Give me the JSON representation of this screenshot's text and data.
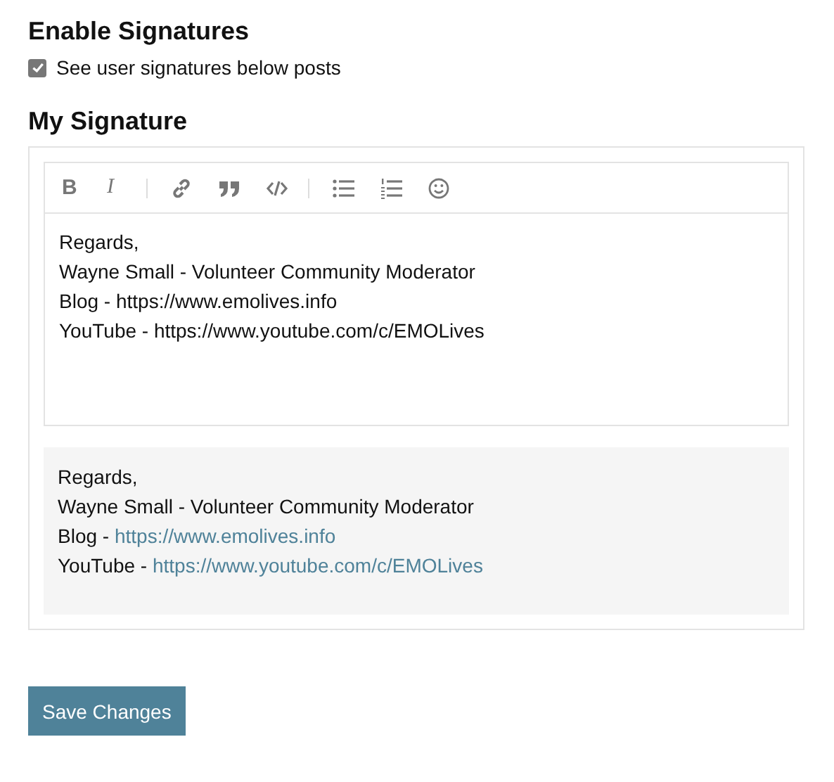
{
  "enable_section": {
    "title": "Enable Signatures",
    "checkbox": {
      "label": "See user signatures below posts",
      "checked": true
    }
  },
  "signature_section": {
    "title": "My Signature",
    "toolbar": [
      {
        "kind": "bold",
        "label": "B"
      },
      {
        "kind": "italic",
        "label": "I"
      },
      {
        "kind": "separator"
      },
      {
        "kind": "link"
      },
      {
        "kind": "quote"
      },
      {
        "kind": "code"
      },
      {
        "kind": "separator"
      },
      {
        "kind": "bullet-list"
      },
      {
        "kind": "numbered-list"
      },
      {
        "kind": "emoji"
      }
    ],
    "editor_lines": [
      "Regards,",
      "Wayne Small - Volunteer Community Moderator",
      "Blog - https://www.emolives.info",
      "YouTube - https://www.youtube.com/c/EMOLives"
    ],
    "preview_lines": [
      {
        "text": "Regards,"
      },
      {
        "text": "Wayne Small - Volunteer Community Moderator"
      },
      {
        "text": "Blog - ",
        "link": "https://www.emolives.info"
      },
      {
        "text": "YouTube - ",
        "link": "https://www.youtube.com/c/EMOLives"
      }
    ]
  },
  "save_button": "Save Changes"
}
